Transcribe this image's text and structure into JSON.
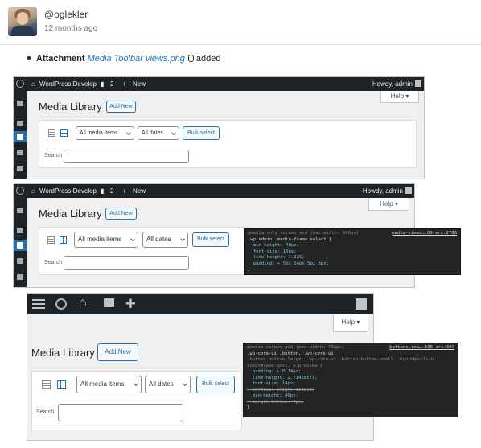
{
  "comment": {
    "username": "@oglekler",
    "time_ago": "12 months ago",
    "attachment_label": "Attachment",
    "attachment_file": "Media Toolbar views.png",
    "attachment_action": "added"
  },
  "adminbar": {
    "site_name": "WordPress Develop",
    "comments_count": "2",
    "new_label": "New",
    "howdy": "Howdy, admin"
  },
  "media": {
    "title": "Media Library",
    "add_new": "Add New",
    "help": "Help ▾",
    "filter_types": "All media items",
    "filter_dates": "All dates",
    "bulk_select": "Bulk select",
    "search_label": "Search"
  },
  "code1": {
    "line1": "@media only screen and (max-width: 900px)",
    "source": "media-views….05-src:2706",
    "line2": ".wp-admin .media-frame select {",
    "line3": "  min-height: 40px;",
    "line4": "  font-size: 16px;",
    "line5": "  line-height: 1.625;",
    "line6": "  padding: ▸ 5px 24px 5px 8px;",
    "line7": "}"
  },
  "code2": {
    "line1": "@media screen and (max-width: 782px)",
    "source": "buttons.css….505-src:347",
    "line2": ".wp-core-ui .button, .wp-core-ui",
    "line3": ".button.button-large, .wp-core-ui .button.button-small, input#publish,",
    "line4": "input#save-post, a.preview {",
    "line5": "  padding: ▸ 0 14px;",
    "line6": "  line-height: 2.71428571;",
    "line7": "  font-size: 14px;",
    "line8": "  vertical-align: middle;",
    "line9": "  min-height: 40px;",
    "line10": "  margin-bottom: 4px;",
    "line11": "}"
  },
  "colors": {
    "adminbar": "#1d2327",
    "accent": "#2271b1",
    "background": "#f0f0f1"
  }
}
